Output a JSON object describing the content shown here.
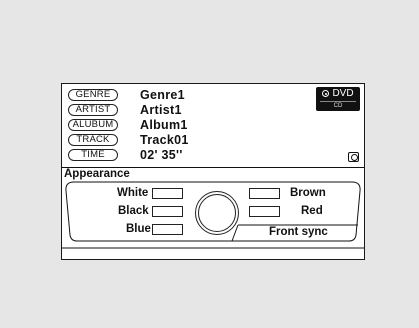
{
  "info": {
    "genre": {
      "tag": "GENRE",
      "value": "Genre1"
    },
    "artist": {
      "tag": "ARTIST",
      "value": "Artist1"
    },
    "album": {
      "tag": "ALUBUM",
      "value": "Album1"
    },
    "track": {
      "tag": "TRACK",
      "value": "Track01"
    },
    "time": {
      "tag": "TIME",
      "value": "02' 35''"
    }
  },
  "source": {
    "primary": "DVD",
    "secondary": "CD",
    "selected": "DVD"
  },
  "appearance": {
    "title": "Appearance",
    "left": [
      "White",
      "Black",
      "Blue"
    ],
    "right": [
      "Brown",
      "Red"
    ],
    "front_sync": "Front sync"
  },
  "icons": {
    "source_selected": "radio-selected-icon",
    "disc": "disc-icon",
    "dial": "dial-knob-icon"
  }
}
